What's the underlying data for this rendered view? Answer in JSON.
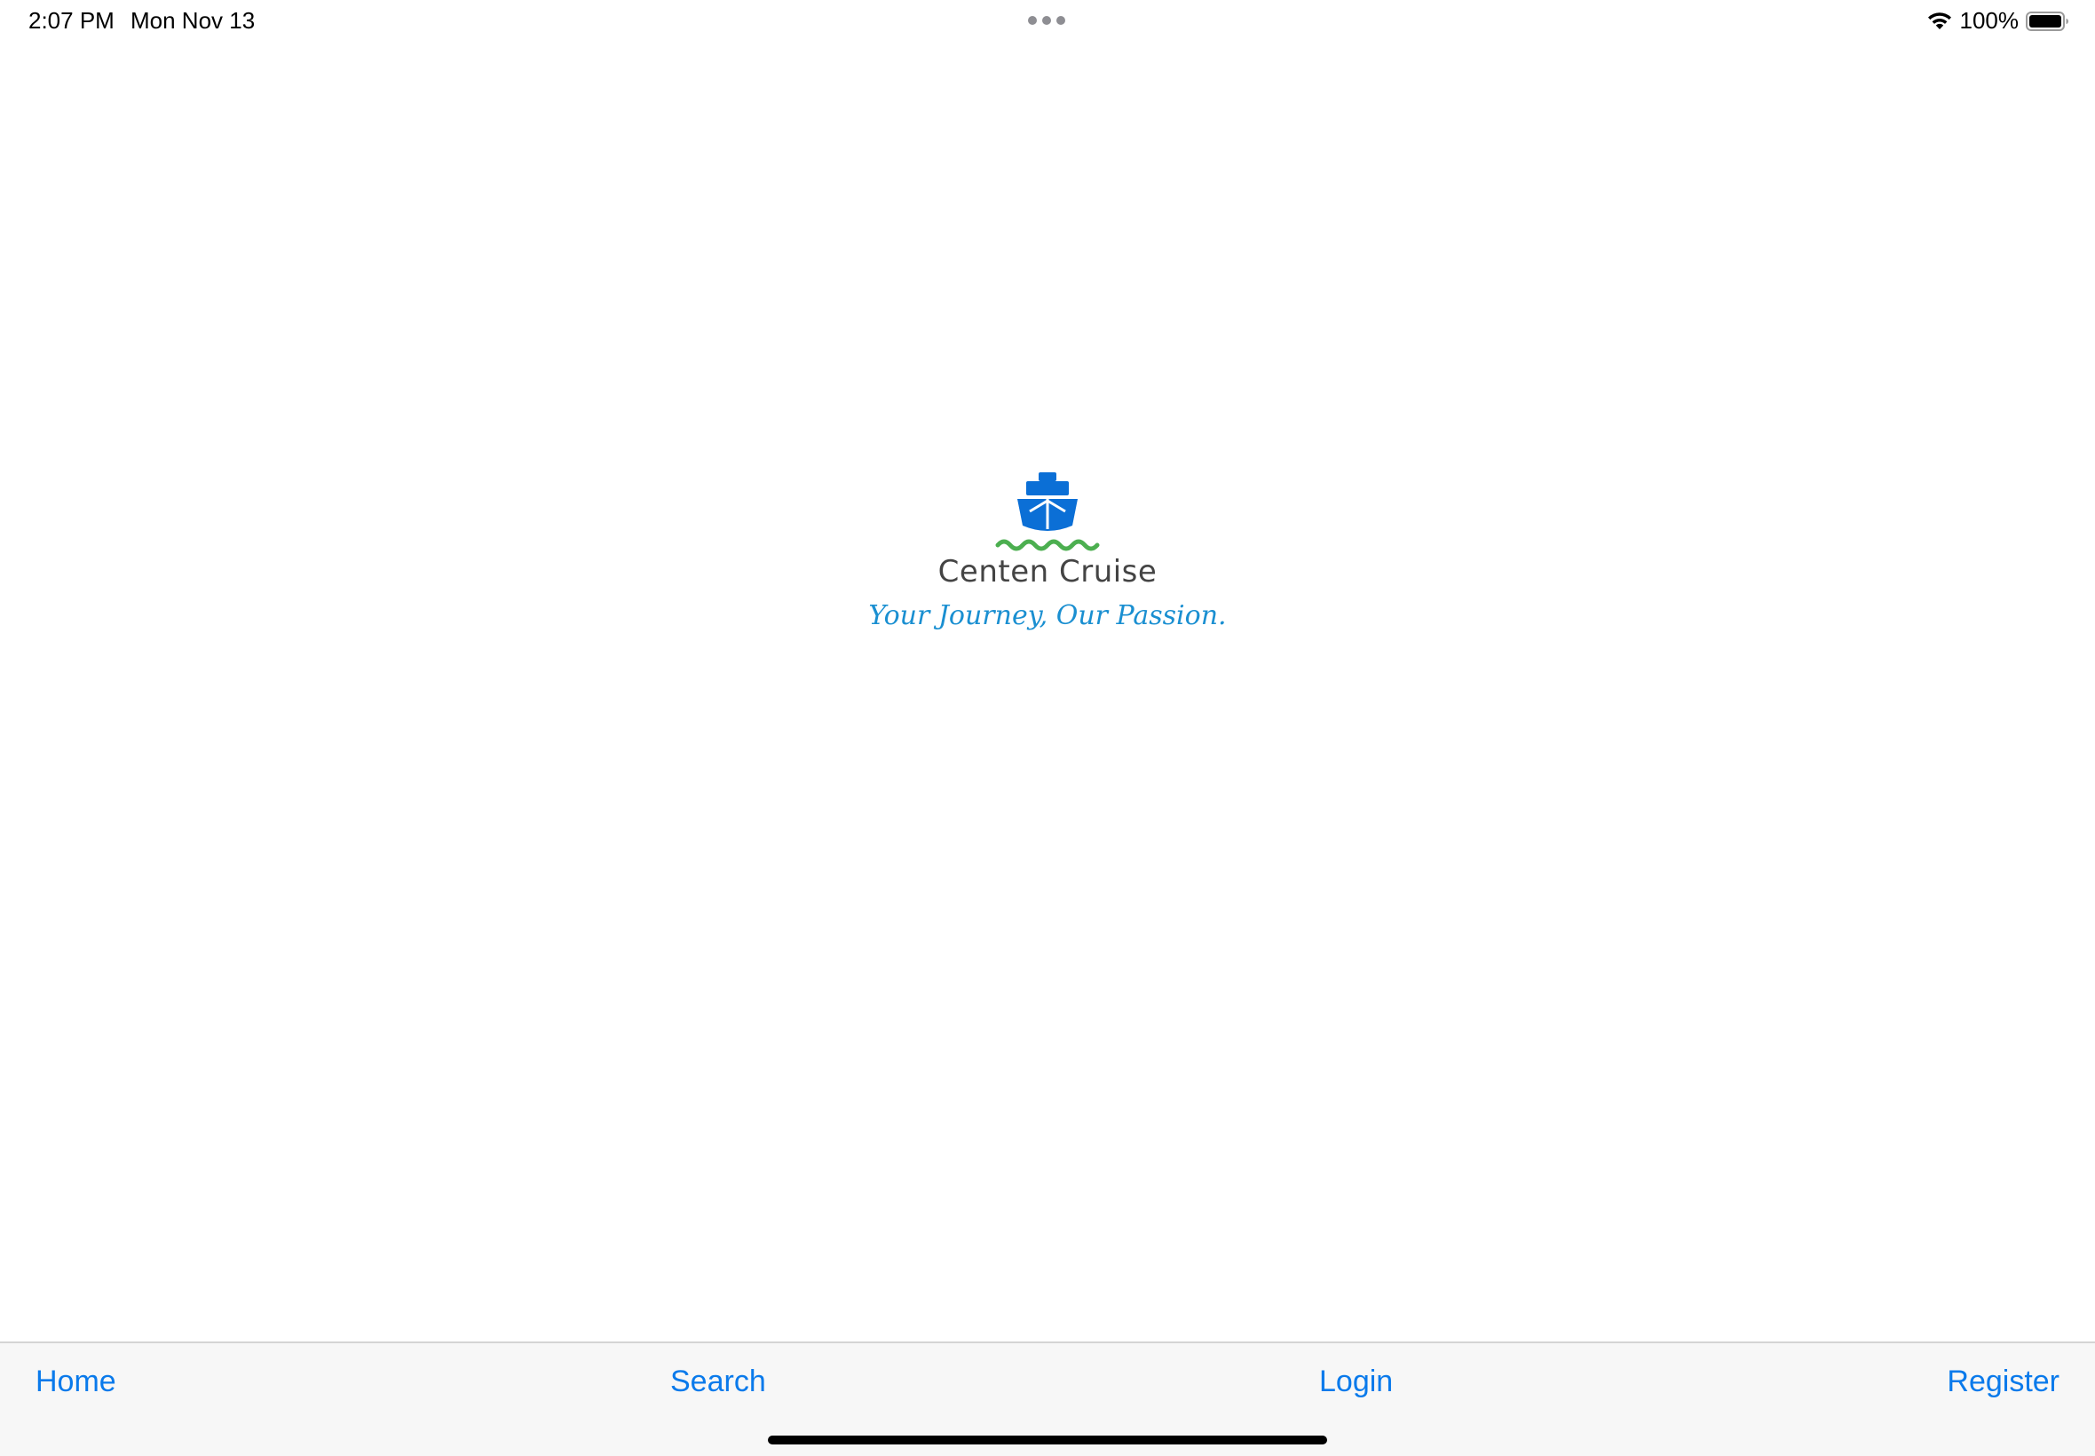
{
  "status_bar": {
    "time": "2:07 PM",
    "date": "Mon Nov 13",
    "battery_percent": "100%",
    "battery_level": 1.0,
    "icons": [
      "wifi-icon",
      "battery-icon",
      "multitask-dots-icon"
    ]
  },
  "logo": {
    "icon": "ship-icon",
    "brand_name": "Centen Cruise",
    "tagline": "Your Journey, Our Passion.",
    "colors": {
      "ship": "#0b6fd6",
      "waves": "#4caf50",
      "brand_text": "#444444",
      "tagline": "#1a8fd1"
    }
  },
  "bottom_nav": {
    "items": [
      {
        "label": "Home"
      },
      {
        "label": "Search"
      },
      {
        "label": "Login"
      },
      {
        "label": "Register"
      }
    ],
    "accent_color": "#0a7aeb"
  }
}
